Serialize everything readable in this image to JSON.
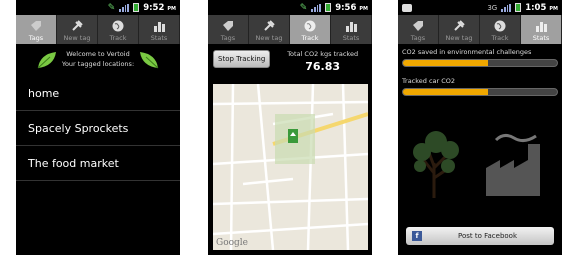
{
  "tabs": [
    "Tags",
    "New tag",
    "Track",
    "Stats"
  ],
  "phone1": {
    "time": "9:52",
    "ampm": "PM",
    "welcome_line1": "Welcome to Vertoid",
    "welcome_line2": "Your tagged locations:",
    "locations": [
      "home",
      "Spacely Sprockets",
      "The food market"
    ]
  },
  "phone2": {
    "time": "9:56",
    "ampm": "PM",
    "stop_button": "Stop Tracking",
    "co2_label": "Total CO2 kgs tracked",
    "co2_value": "76.83",
    "map_logo": "Google"
  },
  "phone3": {
    "time": "1:05",
    "ampm": "PM",
    "label1": "CO2 saved in environmental challenges",
    "bar1_fraction": 0.55,
    "label2": "Tracked car CO2",
    "bar2_fraction": 0.55,
    "facebook_icon": "f",
    "facebook_button": "Post to Facebook"
  },
  "colors": {
    "accent_bar": "#f0a800",
    "leaf_green": "#7ac943",
    "facebook_blue": "#3b5998",
    "tab_active": "#a0a0a0"
  }
}
